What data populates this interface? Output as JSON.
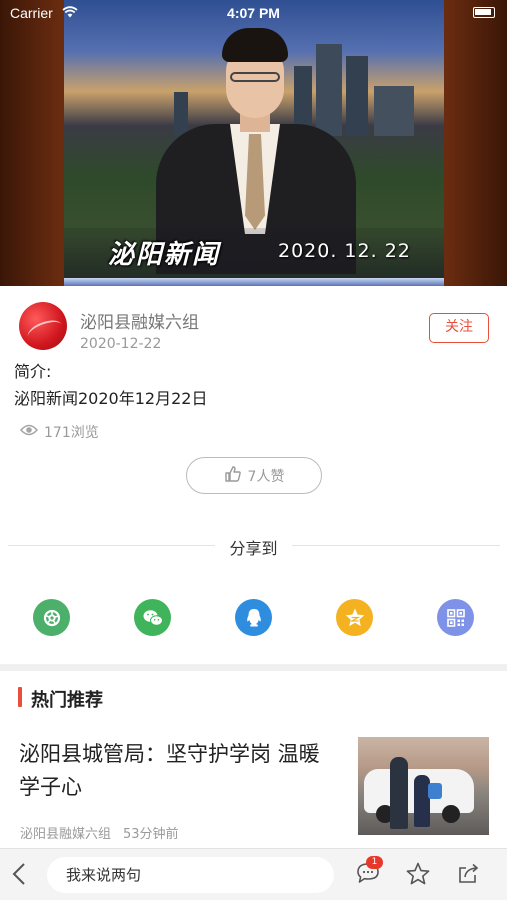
{
  "status_bar": {
    "carrier": "Carrier",
    "time": "4:07 PM"
  },
  "video": {
    "title_overlay": "泌阳新闻",
    "date_overlay": "2020. 12. 22"
  },
  "author": {
    "name": "泌阳县融媒六组",
    "date": "2020-12-22",
    "follow_label": "关注"
  },
  "intro": {
    "label": "简介:",
    "text": "泌阳新闻2020年12月22日"
  },
  "stats": {
    "views": "171浏览",
    "likes": "7人赞"
  },
  "share": {
    "title": "分享到",
    "targets": [
      {
        "name": "moments",
        "icon": "moments-icon",
        "color": "#4caf6a"
      },
      {
        "name": "wechat",
        "icon": "wechat-icon",
        "color": "#3fb45a"
      },
      {
        "name": "qq",
        "icon": "qq-icon",
        "color": "#2f8de0"
      },
      {
        "name": "qzone",
        "icon": "qzone-star-icon",
        "color": "#f4b221"
      },
      {
        "name": "qrcode",
        "icon": "qrcode-icon",
        "color": "#7e93e8"
      }
    ]
  },
  "hot": {
    "section_title": "热门推荐",
    "articles": [
      {
        "title": "泌阳县城管局：坚守护学岗 温暖学子心",
        "source": "泌阳县融媒六组",
        "time": "53分钟前"
      }
    ]
  },
  "bottom_bar": {
    "comment_placeholder": "我来说两句",
    "comment_badge": "1"
  }
}
